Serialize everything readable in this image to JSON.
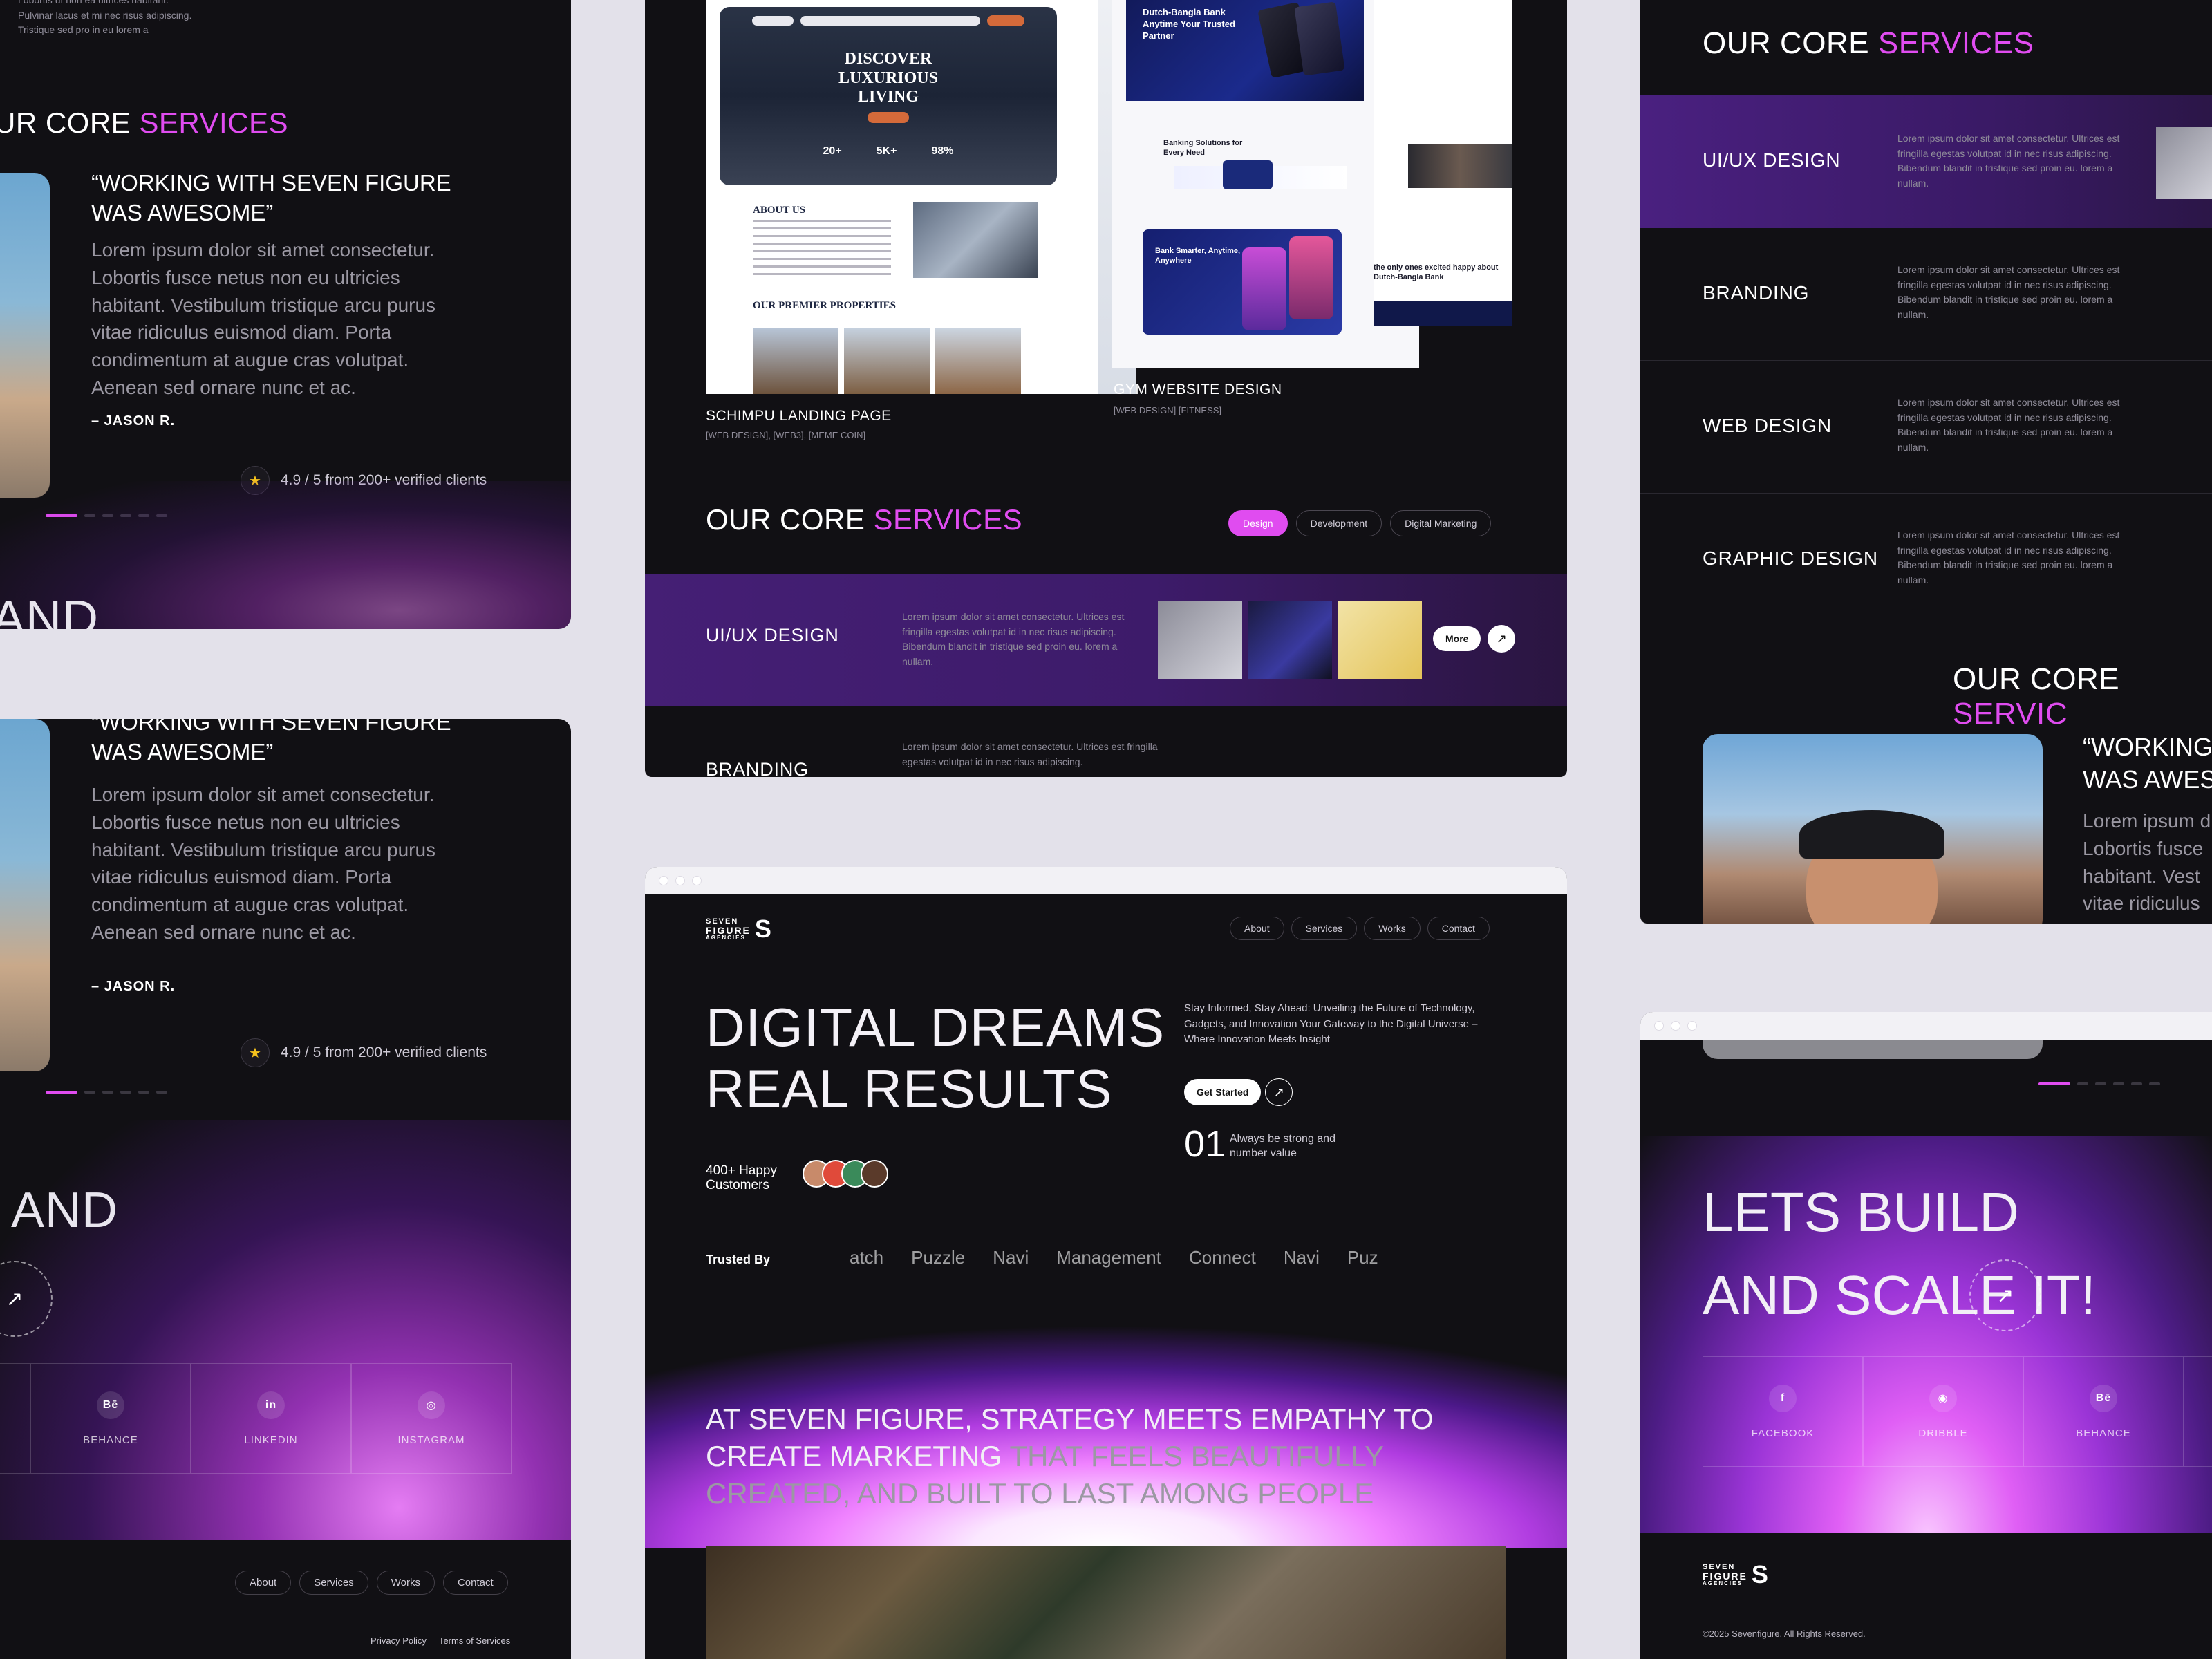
{
  "left_top": {
    "top_line_1": "Lobortis ut non ea ultrices habitant.",
    "top_line_2": "Pulvinar lacus et mi nec risus adipiscing.",
    "top_line_3": "Tristique sed pro in eu lorem a",
    "section_title_main": "UR CORE ",
    "section_title_accent": "SERVICES",
    "quote": "“WORKING WITH SEVEN FIGURE WAS AWESOME”",
    "body": "Lorem ipsum dolor sit amet consectetur. Lobortis fusce netus non eu ultricies habitant. Vestibulum tristique arcu purus vitae ridiculus euismod diam. Porta condimentum at augue cras volutpat. Aenean sed ornare nunc et ac.",
    "author": "– JASON R.",
    "rating_text": "4.9 / 5 from 200+ verified clients",
    "fragment": "AND"
  },
  "left_bottom": {
    "quote": "“WORKING WITH SEVEN FIGURE WAS AWESOME”",
    "body": "Lorem ipsum dolor sit amet consectetur. Lobortis fusce netus non eu ultricies habitant. Vestibulum tristique arcu purus vitae ridiculus euismod diam. Porta condimentum at augue cras volutpat. Aenean sed ornare nunc et ac.",
    "author": "– JASON R.",
    "rating_text": "4.9 / 5 from 200+ verified clients",
    "fragment": "AND",
    "social": [
      {
        "label": "BEHANCE",
        "icon": "Bē"
      },
      {
        "label": "LINKEDIN",
        "icon": "in"
      },
      {
        "label": "INSTAGRAM",
        "icon": "◎"
      }
    ],
    "footer_nav": [
      "About",
      "Services",
      "Works",
      "Contact"
    ],
    "legal": [
      "Privacy Policy",
      "Terms of Services"
    ]
  },
  "mid_top": {
    "projects": [
      {
        "title": "SCHIMPU LANDING PAGE",
        "tags": "[WEB DESIGN], [WEB3], [MEME COIN]"
      },
      {
        "title": "GYM WEBSITE DESIGN",
        "tags": "[WEB DESIGN] [FITNESS]"
      }
    ],
    "thumb1": {
      "hero": "DISCOVER LUXURIOUS LIVING",
      "stats": [
        "20+",
        "5K+",
        "98%"
      ],
      "about": "ABOUT US",
      "props": "OUR PREMIER PROPERTIES"
    },
    "thumb2": {
      "hero": "Dutch-Bangla Bank Anytime Your Trusted Partner",
      "sol": "Banking Solutions for Every Need",
      "smart": "Bank Smarter, Anytime, Anywhere",
      "excited": "the only ones excited happy about Dutch-Bangla Bank"
    },
    "section_title_main": "OUR CORE ",
    "section_title_accent": "SERVICES",
    "tabs": [
      "Design",
      "Development",
      "Digital Marketing"
    ],
    "services": [
      {
        "name": "UI/UX DESIGN",
        "desc": "Lorem ipsum dolor sit amet consectetur. Ultrices est fringilla egestas volutpat id in nec risus adipiscing. Bibendum blandit in tristique sed proin eu. lorem a nullam."
      },
      {
        "name": "BRANDING",
        "desc": "Lorem ipsum dolor sit amet consectetur. Ultrices est fringilla egestas volutpat id in nec risus adipiscing."
      }
    ],
    "more_label": "More"
  },
  "mid_bottom": {
    "logo_line1": "SEVEN",
    "logo_line2": "FIGURE",
    "logo_line3": "AGENCIES",
    "nav": [
      "About",
      "Services",
      "Works",
      "Contact"
    ],
    "hero_title": "DIGITAL DREAMS REAL RESULTS",
    "hero_sub": "Stay Informed, Stay Ahead: Unveiling the Future of Technology, Gadgets, and Innovation Your Gateway to the Digital Universe – Where Innovation Meets Insight",
    "cta": "Get Started",
    "stat_num": "01",
    "stat_text": "Always be strong and number value",
    "happy": "400+ Happy Customers",
    "trusted": "Trusted By",
    "brands": [
      "atch",
      "Puzzle",
      "Navi",
      "Management",
      "Connect",
      "Navi",
      "Puz"
    ],
    "statement_main": "AT SEVEN FIGURE, STRATEGY MEETS EMPATHY TO CREATE MARKETING ",
    "statement_dim": "THAT FEELS BEAUTIFULLY CREATED, AND BUILT TO LAST AMONG PEOPLE"
  },
  "right_top": {
    "section_title_main": "OUR CORE ",
    "section_title_accent": "SERVICES",
    "services": [
      {
        "name": "UI/UX DESIGN",
        "desc": "Lorem ipsum dolor sit amet consectetur. Ultrices est fringilla egestas volutpat id in nec risus adipiscing. Bibendum blandit in tristique sed proin eu. lorem a nullam."
      },
      {
        "name": "BRANDING",
        "desc": "Lorem ipsum dolor sit amet consectetur. Ultrices est fringilla egestas volutpat id in nec risus adipiscing. Bibendum blandit in tristique sed proin eu. lorem a nullam."
      },
      {
        "name": "WEB DESIGN",
        "desc": "Lorem ipsum dolor sit amet consectetur. Ultrices est fringilla egestas volutpat id in nec risus adipiscing. Bibendum blandit in tristique sed proin eu. lorem a nullam."
      },
      {
        "name": "GRAPHIC DESIGN",
        "desc": "Lorem ipsum dolor sit amet consectetur. Ultrices est fringilla egestas volutpat id in nec risus adipiscing. Bibendum blandit in tristique sed proin eu. lorem a nullam."
      }
    ],
    "section2_main": "OUR CORE ",
    "section2_accent": "SERVIC",
    "quote": "“WORKING WAS AWES",
    "body": "Lorem ipsum d Lobortis fusce habitant. Vest vitae ridiculus"
  },
  "right_bottom": {
    "headline": "LETS BUILD AND SCALE IT!",
    "social": [
      {
        "label": "FACEBOOK",
        "icon": "f"
      },
      {
        "label": "DRIBBLE",
        "icon": "◉"
      },
      {
        "label": "BEHANCE",
        "icon": "Bē"
      }
    ],
    "logo_line1": "SEVEN",
    "logo_line2": "FIGURE",
    "logo_line3": "AGENCIES",
    "copyright": "©2025 Sevenfigure. All Rights Reserved."
  },
  "colors": {
    "accent": "#e04cf0",
    "bg": "#111014",
    "canvas": "#e3e1ea"
  }
}
